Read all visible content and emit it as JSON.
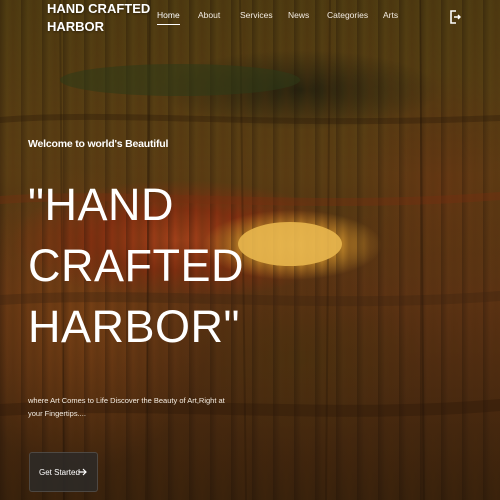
{
  "brand": {
    "logo_text": "HAND CRAFTED HARBOR"
  },
  "nav": {
    "items": [
      {
        "label": "Home",
        "active": true
      },
      {
        "label": "About",
        "active": false
      },
      {
        "label": "Services",
        "active": false
      },
      {
        "label": "News",
        "active": false
      },
      {
        "label": "Categories",
        "active": false
      },
      {
        "label": "Arts",
        "active": false
      }
    ],
    "user_icon": "user-login-icon"
  },
  "hero": {
    "welcome": "Welcome to world's Beautiful",
    "title": "\"HAND\nCRAFTED\nHARBOR\"",
    "tagline": "where Art Comes to Life Discover the Beauty of Art,Right at your Fingertips....",
    "cta_label": "Get Started",
    "cta_icon": "arrow-right-icon"
  },
  "colors": {
    "text": "#ffffff",
    "button_bg": "#2d2a28",
    "background_dominant": "#5d3e14"
  }
}
